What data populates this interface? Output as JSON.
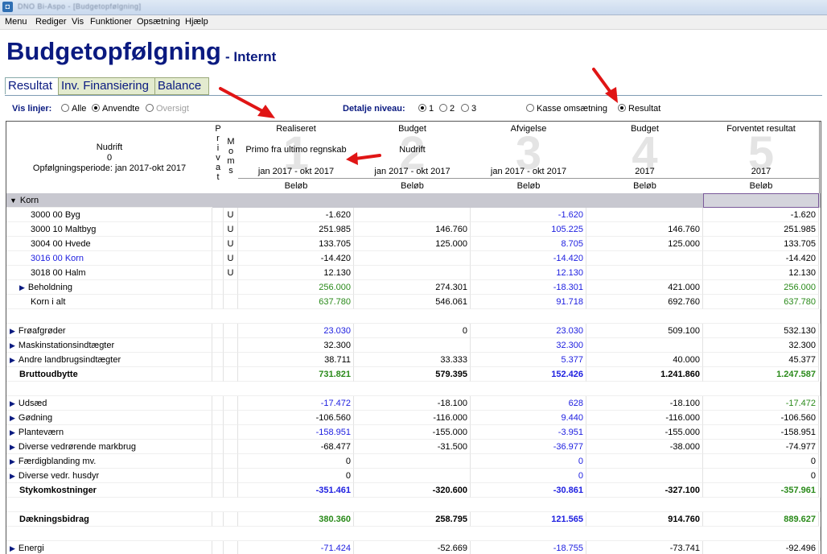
{
  "window": {
    "title": "DNO Bi-Aspo - [Budgetopfølgning]"
  },
  "menu": [
    "Menu",
    "Rediger",
    "Vis",
    "Funktioner",
    "Opsætning",
    "Hjælp"
  ],
  "page": {
    "title": "Budgetopfølgning",
    "subtitle": "- Internt"
  },
  "tabs": [
    {
      "label": "Resultat",
      "active": true
    },
    {
      "label": "Inv. Finansiering",
      "active": false
    },
    {
      "label": "Balance",
      "active": false
    }
  ],
  "filters": {
    "vis_linjer_label": "Vis linjer:",
    "vis_linjer_options": [
      {
        "label": "Alle",
        "selected": false,
        "enabled": true
      },
      {
        "label": "Anvendte",
        "selected": true,
        "enabled": true
      },
      {
        "label": "Oversigt",
        "selected": false,
        "enabled": false
      }
    ],
    "detalje_label": "Detalje niveau:",
    "detalje_options": [
      {
        "label": "1",
        "selected": true
      },
      {
        "label": "2",
        "selected": false
      },
      {
        "label": "3",
        "selected": false
      }
    ],
    "view_options": [
      {
        "label": "Kasse omsætning",
        "selected": false
      },
      {
        "label": "Resultat",
        "selected": true
      }
    ]
  },
  "table": {
    "desc_header": {
      "line1": "Nudrift",
      "line2": "0",
      "line3": "Opfølgningsperiode: jan 2017-okt 2017"
    },
    "privat_header": [
      "P",
      "r",
      "i",
      "v",
      "a",
      "t"
    ],
    "moms_header": [
      "M",
      "o",
      "m",
      "s"
    ],
    "columns": [
      {
        "num": "1",
        "title": "Realiseret",
        "sub": "Primo fra ultimo regnskab",
        "period": "jan 2017 - okt 2017",
        "unit": "Beløb"
      },
      {
        "num": "2",
        "title": "Budget",
        "sub": "Nudrift",
        "period": "jan 2017 - okt 2017",
        "unit": "Beløb"
      },
      {
        "num": "3",
        "title": "Afvigelse",
        "sub": "",
        "period": "jan 2017 - okt 2017",
        "unit": "Beløb"
      },
      {
        "num": "4",
        "title": "Budget",
        "sub": "",
        "period": "2017",
        "unit": "Beløb"
      },
      {
        "num": "5",
        "title": "Forventet resultat",
        "sub": "",
        "period": "2017",
        "unit": "Beløb"
      }
    ],
    "rows": [
      {
        "type": "group",
        "label": "Korn",
        "expander": "▼"
      },
      {
        "label": "3000 00 Byg",
        "indent": 2,
        "moms": "U",
        "v": [
          "-1.620",
          "",
          "-1.620",
          "",
          "-1.620"
        ],
        "c": [
          "black",
          "black",
          "blue",
          "black",
          "black"
        ]
      },
      {
        "label": "3000 10 Maltbyg",
        "indent": 2,
        "moms": "U",
        "v": [
          "251.985",
          "146.760",
          "105.225",
          "146.760",
          "251.985"
        ],
        "c": [
          "black",
          "black",
          "blue",
          "black",
          "black"
        ]
      },
      {
        "label": "3004 00 Hvede",
        "indent": 2,
        "moms": "U",
        "v": [
          "133.705",
          "125.000",
          "8.705",
          "125.000",
          "133.705"
        ],
        "c": [
          "black",
          "black",
          "blue",
          "black",
          "black"
        ]
      },
      {
        "label": "3016 00 Korn",
        "indent": 2,
        "moms": "U",
        "labelColor": "blue",
        "v": [
          "-14.420",
          "",
          "-14.420",
          "",
          "-14.420"
        ],
        "c": [
          "black",
          "black",
          "blue",
          "black",
          "black"
        ]
      },
      {
        "label": "3018 00 Halm",
        "indent": 2,
        "moms": "U",
        "v": [
          "12.130",
          "",
          "12.130",
          "",
          "12.130"
        ],
        "c": [
          "black",
          "black",
          "blue",
          "black",
          "black"
        ]
      },
      {
        "label": "Beholdning",
        "indent": 1,
        "expander": "▶",
        "v": [
          "256.000",
          "274.301",
          "-18.301",
          "421.000",
          "256.000"
        ],
        "c": [
          "green",
          "black",
          "blue",
          "black",
          "green"
        ]
      },
      {
        "label": "Korn i alt",
        "indent": 2,
        "v": [
          "637.780",
          "546.061",
          "91.718",
          "692.760",
          "637.780"
        ],
        "c": [
          "green",
          "black",
          "blue",
          "black",
          "green"
        ]
      },
      {
        "type": "blank"
      },
      {
        "label": "Frøafgrøder",
        "indent": 0,
        "expander": "▶",
        "v": [
          "23.030",
          "0",
          "23.030",
          "509.100",
          "532.130"
        ],
        "c": [
          "blue",
          "black",
          "blue",
          "black",
          "black"
        ]
      },
      {
        "label": "Maskinstationsindtægter",
        "indent": 0,
        "expander": "▶",
        "v": [
          "32.300",
          "",
          "32.300",
          "",
          "32.300"
        ],
        "c": [
          "black",
          "black",
          "blue",
          "black",
          "black"
        ]
      },
      {
        "label": "Andre landbrugsindtægter",
        "indent": 0,
        "expander": "▶",
        "v": [
          "38.711",
          "33.333",
          "5.377",
          "40.000",
          "45.377"
        ],
        "c": [
          "black",
          "black",
          "blue",
          "black",
          "black"
        ]
      },
      {
        "label": "Bruttoudbytte",
        "indent": 0,
        "bold": true,
        "v": [
          "731.821",
          "579.395",
          "152.426",
          "1.241.860",
          "1.247.587"
        ],
        "c": [
          "green",
          "black",
          "blue",
          "black",
          "green"
        ]
      },
      {
        "type": "blank"
      },
      {
        "label": "Udsæd",
        "indent": 0,
        "expander": "▶",
        "v": [
          "-17.472",
          "-18.100",
          "628",
          "-18.100",
          "-17.472"
        ],
        "c": [
          "blue",
          "black",
          "blue",
          "black",
          "green"
        ]
      },
      {
        "label": "Gødning",
        "indent": 0,
        "expander": "▶",
        "v": [
          "-106.560",
          "-116.000",
          "9.440",
          "-116.000",
          "-106.560"
        ],
        "c": [
          "black",
          "black",
          "blue",
          "black",
          "black"
        ]
      },
      {
        "label": "Planteværn",
        "indent": 0,
        "expander": "▶",
        "v": [
          "-158.951",
          "-155.000",
          "-3.951",
          "-155.000",
          "-158.951"
        ],
        "c": [
          "blue",
          "black",
          "blue",
          "black",
          "black"
        ]
      },
      {
        "label": "Diverse vedrørende markbrug",
        "indent": 0,
        "expander": "▶",
        "v": [
          "-68.477",
          "-31.500",
          "-36.977",
          "-38.000",
          "-74.977"
        ],
        "c": [
          "black",
          "black",
          "blue",
          "black",
          "black"
        ]
      },
      {
        "label": "Færdigblanding mv.",
        "indent": 0,
        "expander": "▶",
        "v": [
          "0",
          "",
          "0",
          "",
          "0"
        ],
        "c": [
          "black",
          "black",
          "blue",
          "black",
          "black"
        ]
      },
      {
        "label": "Diverse vedr. husdyr",
        "indent": 0,
        "expander": "▶",
        "v": [
          "0",
          "",
          "0",
          "",
          "0"
        ],
        "c": [
          "black",
          "black",
          "blue",
          "black",
          "black"
        ]
      },
      {
        "label": "Stykomkostninger",
        "indent": 0,
        "bold": true,
        "v": [
          "-351.461",
          "-320.600",
          "-30.861",
          "-327.100",
          "-357.961"
        ],
        "c": [
          "blue",
          "black",
          "blue",
          "black",
          "green"
        ]
      },
      {
        "type": "blank"
      },
      {
        "label": "Dækningsbidrag",
        "indent": 0,
        "bold": true,
        "v": [
          "380.360",
          "258.795",
          "121.565",
          "914.760",
          "889.627"
        ],
        "c": [
          "green",
          "black",
          "blue",
          "black",
          "green"
        ]
      },
      {
        "type": "blank"
      },
      {
        "label": "Energi",
        "indent": 0,
        "expander": "▶",
        "v": [
          "-71.424",
          "-52.669",
          "-18.755",
          "-73.741",
          "-92.496"
        ],
        "c": [
          "blue",
          "black",
          "blue",
          "black",
          "black"
        ]
      }
    ]
  },
  "colors": {
    "title": "#0a1a80",
    "blue_value": "#1f20e0",
    "green_value": "#2a8a1a",
    "annotation_arrow": "#e01515"
  }
}
